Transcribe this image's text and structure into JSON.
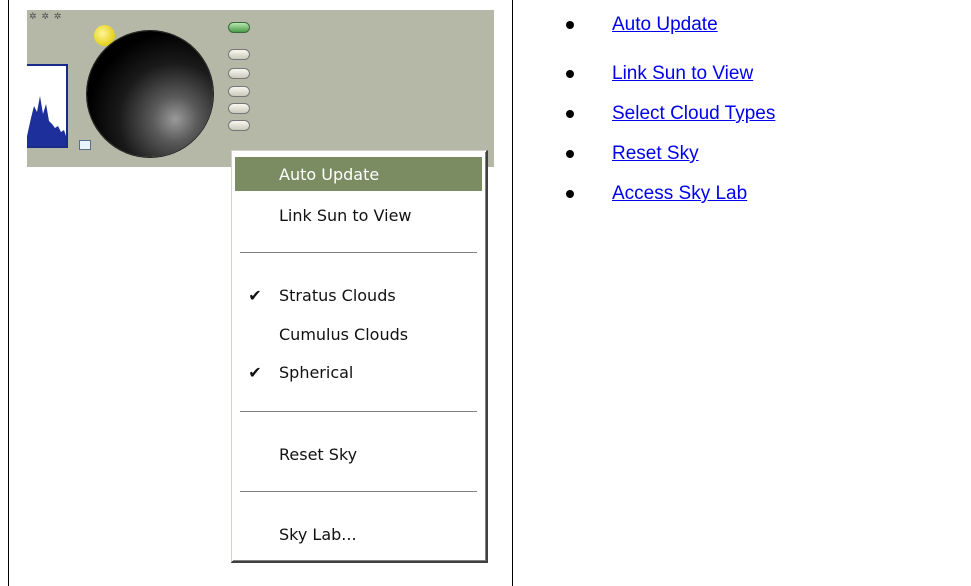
{
  "menu": {
    "items": [
      {
        "label": "Auto Update",
        "checked": false,
        "highlighted": true
      },
      {
        "label": "Link Sun to View",
        "checked": false,
        "highlighted": false
      },
      {
        "label": "Stratus Clouds",
        "checked": true,
        "highlighted": false
      },
      {
        "label": "Cumulus Clouds",
        "checked": false,
        "highlighted": false
      },
      {
        "label": "Spherical",
        "checked": true,
        "highlighted": false
      },
      {
        "label": "Reset Sky",
        "checked": false,
        "highlighted": false
      },
      {
        "label": "Sky Lab...",
        "checked": false,
        "highlighted": false
      }
    ],
    "check_glyph": "✔",
    "highlight_color": "#7c8c62"
  },
  "links": [
    {
      "label": "Auto Update"
    },
    {
      "label": "Link Sun to View"
    },
    {
      "label": "Select Cloud Types"
    },
    {
      "label": "Reset Sky"
    },
    {
      "label": "Access Sky Lab"
    }
  ],
  "panel": {
    "background_color": "#b5b8a6",
    "icons": [
      "histogram-icon",
      "sun-dot-icon",
      "sky-knob-icon",
      "indicator-light-icon"
    ]
  }
}
